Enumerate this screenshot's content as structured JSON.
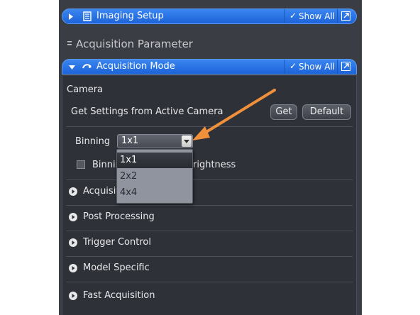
{
  "imaging_setup": {
    "title": "Imaging Setup",
    "show_all": "Show All"
  },
  "acquisition_parameter": {
    "title": "Acquisition Parameter"
  },
  "acquisition_mode": {
    "title": "Acquisition Mode",
    "show_all": "Show All",
    "camera_label": "Camera",
    "get_settings_label": "Get Settings from Active Camera",
    "get_button": "Get",
    "default_button": "Default",
    "binning_label": "Binning",
    "binning_value": "1x1",
    "binning_options": [
      "1x1",
      "2x2",
      "4x4"
    ],
    "checkbox_label_left": "Binnin",
    "checkbox_label_right": "rightness",
    "sections": [
      "Acquisiti",
      "Post Processing",
      "Trigger Control",
      "Model Specific",
      "Fast Acquisition"
    ]
  },
  "colors": {
    "accent_blue": "#2a72e6",
    "annotation_arrow": "#f0903a",
    "panel_bg": "#2e3138"
  }
}
